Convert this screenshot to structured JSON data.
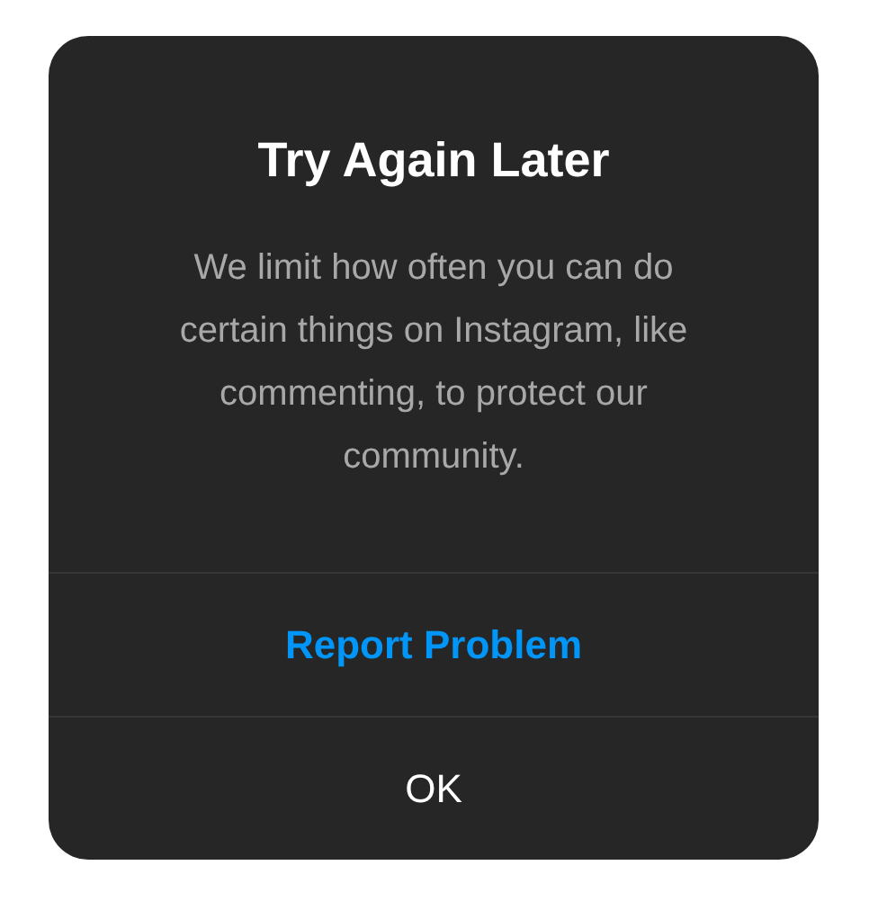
{
  "dialog": {
    "title": "Try Again Later",
    "message": "We limit how often you can do certain things on Instagram, like commenting, to protect our community.",
    "buttons": [
      {
        "label": "Report Problem",
        "kind": "primary"
      },
      {
        "label": "OK",
        "kind": "plain"
      }
    ]
  }
}
